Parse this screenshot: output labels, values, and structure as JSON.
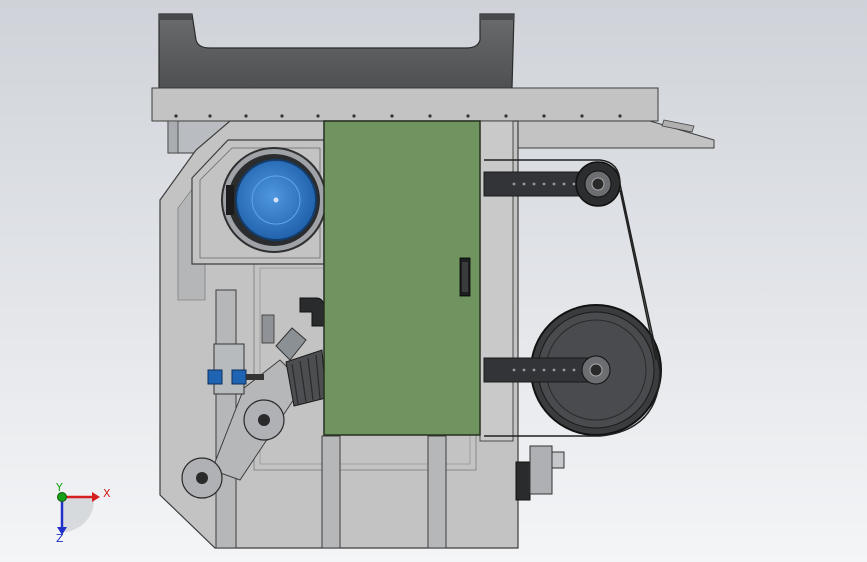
{
  "scene": {
    "background_top": "#cfd3d9",
    "background_bottom": "#f4f5f7",
    "frame_color": "#c3c3c3",
    "frame_edge": "#4a4a4a",
    "hood_color": "#5f6062",
    "cabinet_color": "#6f9460",
    "motor_color": "#2e78c8",
    "wheel_color": "#3b3c3e",
    "arm_color": "#2f3032"
  },
  "triad": {
    "x_label": "X",
    "y_label": "Y",
    "z_label": "Z",
    "x_color": "#d52020",
    "y_color": "#18a018",
    "z_color": "#2030c8"
  }
}
